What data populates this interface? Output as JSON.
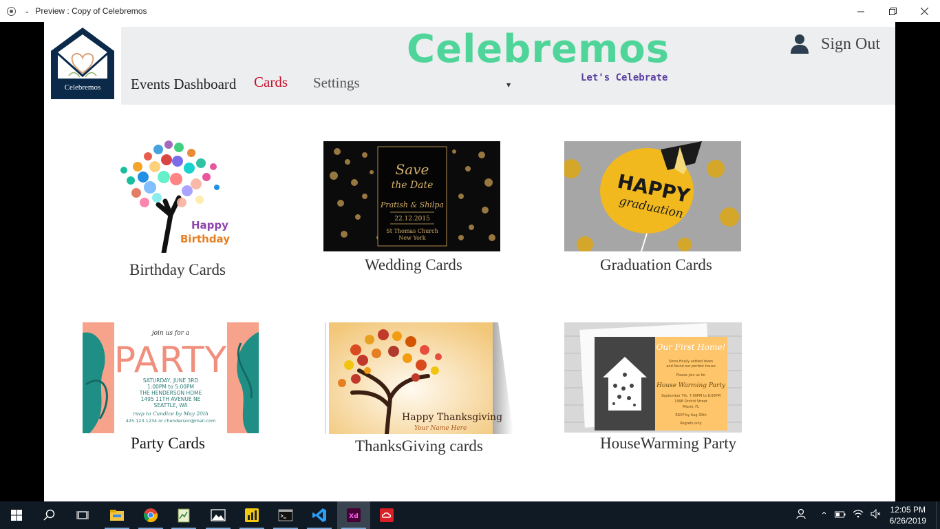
{
  "window": {
    "title": "Preview : Copy of Celebremos",
    "controls": [
      "minimize",
      "restore",
      "close"
    ]
  },
  "logo": {
    "text": "Celebremos"
  },
  "header": {
    "brand": "Celebremos",
    "tagline": "Let's Celebrate",
    "nav": {
      "events_dashboard": "Events Dashboard",
      "cards": "Cards",
      "settings": "Settings"
    },
    "sign_out": "Sign Out"
  },
  "cards": [
    {
      "label": "Birthday Cards",
      "image_text": [
        "Happy",
        "Birthday"
      ]
    },
    {
      "label": "Wedding Cards",
      "image_text": [
        "Save",
        "the Date",
        "Pratish & Shilpa",
        "22.12.2015",
        "St Thomas Church",
        "New York"
      ]
    },
    {
      "label": "Graduation Cards",
      "image_text": [
        "HAPPY",
        "graduation"
      ]
    },
    {
      "label": "Party Cards",
      "image_text": [
        "join us for a",
        "PARTY",
        "SATURDAY, JUNE 3RD",
        "1:00PM to 5:00PM",
        "THE HENDERSON HOME",
        "1495 11TH AVENUE NE",
        "SEATTLE, WA",
        "rsvp to Candice by May 20th",
        "425.123.1234 or chenderson@mail.com"
      ]
    },
    {
      "label": "ThanksGiving cards",
      "image_text": [
        "Happy Thanksgiving",
        "Your Name Here"
      ]
    },
    {
      "label": "HouseWarming Party",
      "image_text": [
        "Our First Home!",
        "House Warming Party"
      ]
    }
  ],
  "colors": {
    "brand": "#4fd59a",
    "tagline": "#5b3fa0",
    "active_nav": "#c8102e",
    "header_bg": "#edeeef",
    "logo_bg": "#0b2a4a",
    "taskbar_bg": "#0f1a24"
  },
  "taskbar": {
    "icons": [
      "windows-start-icon",
      "search-icon",
      "task-view-icon",
      "file-explorer-icon",
      "chrome-icon",
      "notepad-icon",
      "photos-icon",
      "power-bi-icon",
      "terminal-icon",
      "vscode-icon",
      "adobe-xd-icon",
      "creative-cloud-icon"
    ],
    "time": "12:05 PM",
    "date": "6/26/2019"
  }
}
